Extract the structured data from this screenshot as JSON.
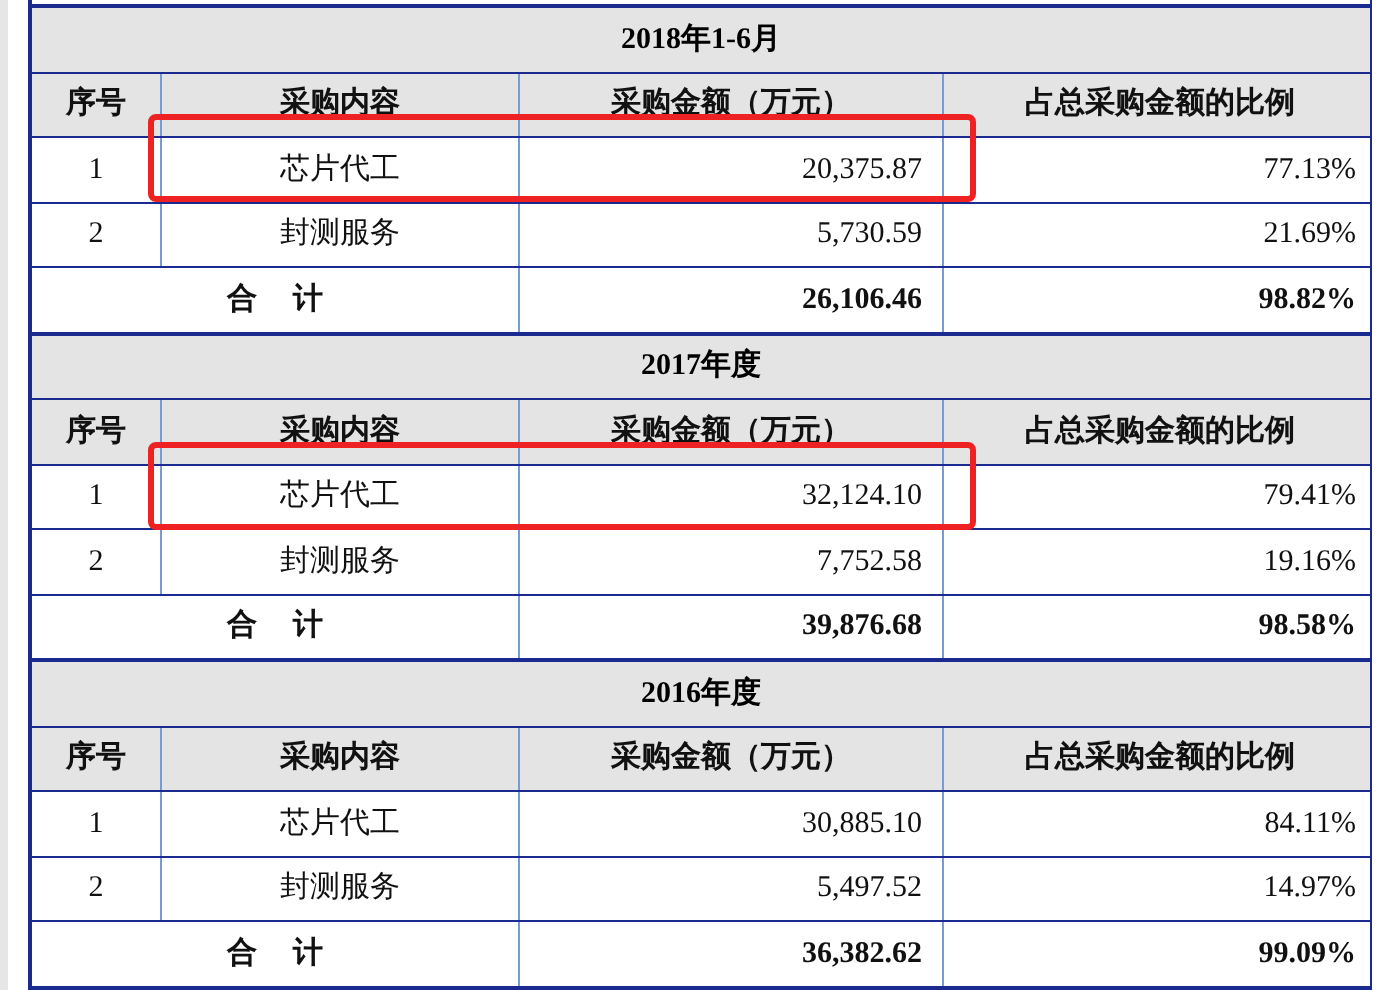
{
  "sections": [
    {
      "title": "2018年1-6月",
      "columns": [
        "序号",
        "采购内容",
        "采购金额（万元）",
        "占总采购金额的比例"
      ],
      "rows": [
        {
          "index": "1",
          "item": "芯片代工",
          "amount": "20,375.87",
          "share": "77.13%",
          "highlighted": true
        },
        {
          "index": "2",
          "item": "封测服务",
          "amount": "5,730.59",
          "share": "21.69%",
          "highlighted": false
        }
      ],
      "total": {
        "label": "合 计",
        "amount": "26,106.46",
        "share": "98.82%"
      }
    },
    {
      "title": "2017年度",
      "columns": [
        "序号",
        "采购内容",
        "采购金额（万元）",
        "占总采购金额的比例"
      ],
      "rows": [
        {
          "index": "1",
          "item": "芯片代工",
          "amount": "32,124.10",
          "share": "79.41%",
          "highlighted": true
        },
        {
          "index": "2",
          "item": "封测服务",
          "amount": "7,752.58",
          "share": "19.16%",
          "highlighted": false
        }
      ],
      "total": {
        "label": "合 计",
        "amount": "39,876.68",
        "share": "98.58%"
      }
    },
    {
      "title": "2016年度",
      "columns": [
        "序号",
        "采购内容",
        "采购金额（万元）",
        "占总采购金额的比例"
      ],
      "rows": [
        {
          "index": "1",
          "item": "芯片代工",
          "amount": "30,885.10",
          "share": "84.11%",
          "highlighted": false
        },
        {
          "index": "2",
          "item": "封测服务",
          "amount": "5,497.52",
          "share": "14.97%",
          "highlighted": false
        }
      ],
      "total": {
        "label": "合 计",
        "amount": "36,382.62",
        "share": "99.09%"
      }
    }
  ]
}
